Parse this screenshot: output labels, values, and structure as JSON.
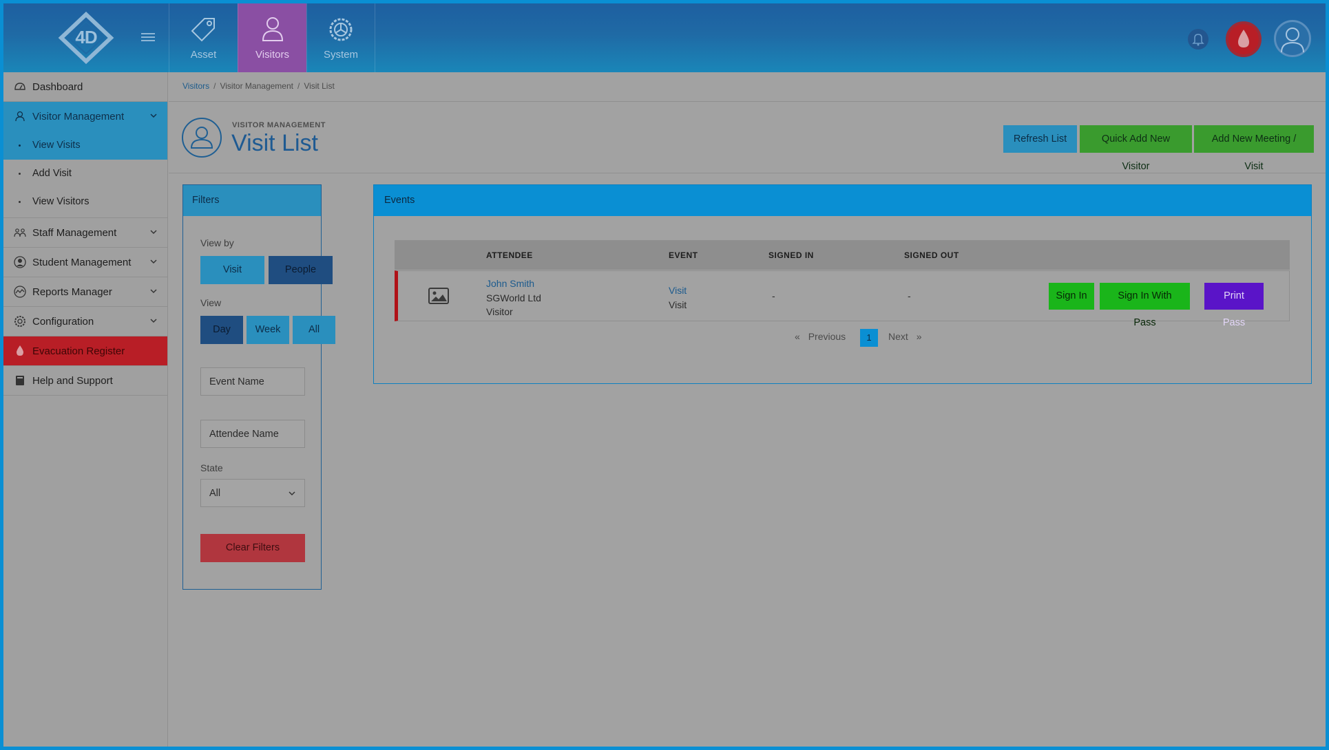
{
  "topbar": {
    "logo_text": "4D",
    "modules": [
      {
        "label": "Asset"
      },
      {
        "label": "Visitors"
      },
      {
        "label": "System"
      }
    ]
  },
  "sidebar": {
    "items": [
      {
        "label": "Dashboard"
      },
      {
        "label": "Visitor Management"
      },
      {
        "label": "Staff Management"
      },
      {
        "label": "Student Management"
      },
      {
        "label": "Reports Manager"
      },
      {
        "label": "Configuration"
      },
      {
        "label": "Evacuation Register"
      },
      {
        "label": "Help and Support"
      }
    ],
    "sub_items": [
      {
        "label": "View Visits"
      },
      {
        "label": "Add Visit"
      },
      {
        "label": "View Visitors"
      }
    ]
  },
  "breadcrumb": [
    "Visitors",
    "Visitor Management",
    "Visit List"
  ],
  "page": {
    "subtitle": "VISITOR MANAGEMENT",
    "title": "Visit List",
    "buttons": {
      "refresh": "Refresh List",
      "quick_add": "Quick Add New Visitor",
      "add_meeting": "Add New Meeting / Visit"
    }
  },
  "filters": {
    "title": "Filters",
    "view_by_label": "View by",
    "view_by_options": [
      "Visit",
      "People"
    ],
    "view_label": "View",
    "view_options": [
      "Day",
      "Week",
      "All"
    ],
    "event_name_placeholder": "Event Name",
    "attendee_name_placeholder": "Attendee Name",
    "state_label": "State",
    "state_value": "All",
    "clear_button": "Clear Filters"
  },
  "events": {
    "title": "Events",
    "columns": [
      "ATTENDEE",
      "EVENT",
      "SIGNED IN",
      "SIGNED OUT"
    ],
    "rows": [
      {
        "attendee_name": "John Smith",
        "company": "SGWorld Ltd",
        "type": "Visitor",
        "event_link": "Visit",
        "event_type": "Visit",
        "signed_in": "-",
        "signed_out": "-",
        "actions": {
          "sign_in": "Sign In",
          "sign_in_pass": "Sign In With Pass",
          "print_pass": "Print Pass"
        }
      }
    ],
    "pagination": {
      "previous": "Previous",
      "page": "1",
      "next": "Next",
      "prev_arrow": "«",
      "next_arrow": "»"
    }
  },
  "colors": {
    "topbar": "#1f6aa5",
    "visitors_tab": "#8a4fa3",
    "sidebar_active": "#2a8fbd",
    "evacuation": "#b81e26",
    "primary_btn": "#2a8fbd",
    "success_btn": "#3a9b2e",
    "sign_in_btn": "#1ab51a",
    "print_pass_btn": "#5a14c8",
    "clear_btn": "#b0363e",
    "dark_btn": "#1f4d80"
  }
}
